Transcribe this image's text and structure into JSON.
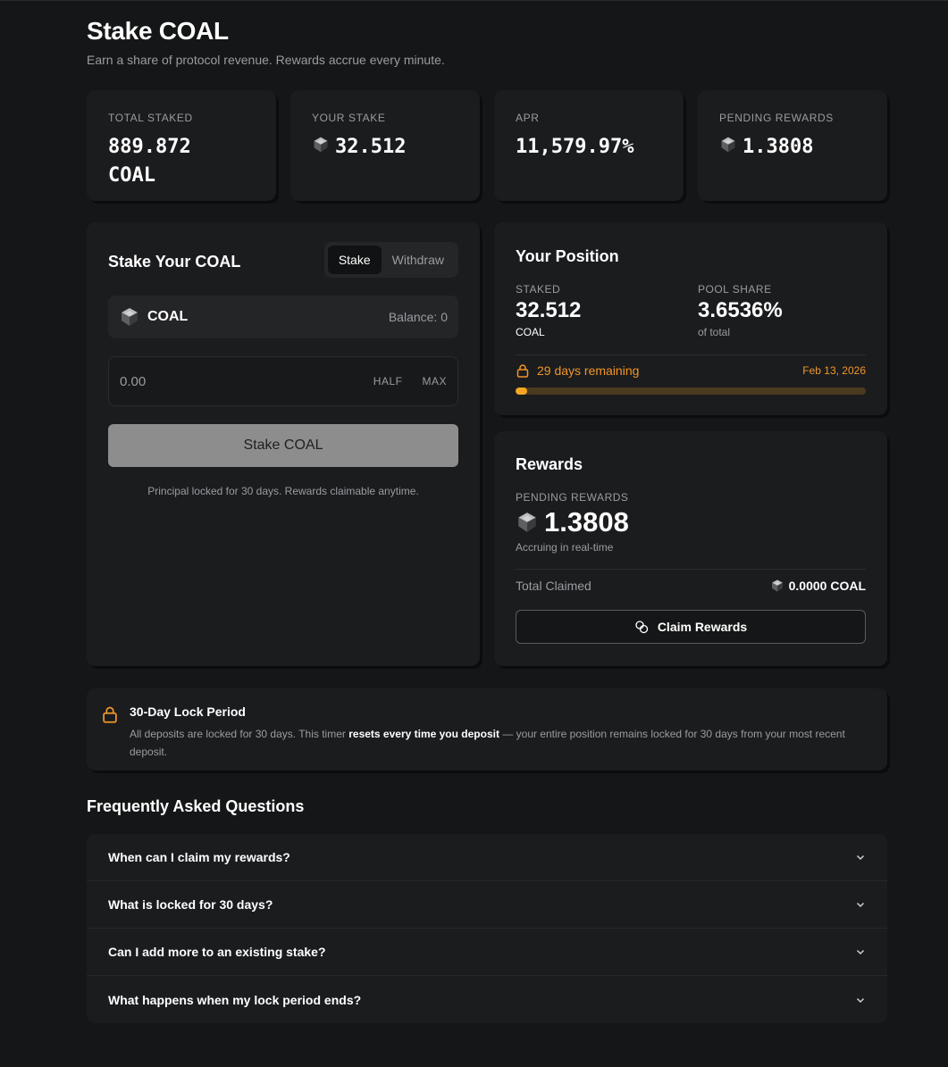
{
  "header": {
    "title": "Stake COAL",
    "subtitle": "Earn a share of protocol revenue. Rewards accrue every minute."
  },
  "stats": [
    {
      "label": "TOTAL STAKED",
      "value": "889.872 COAL",
      "value_line1": "889.872",
      "value_line2": "COAL",
      "icon": null
    },
    {
      "label": "YOUR STAKE",
      "value": "32.512",
      "icon": "coal-icon"
    },
    {
      "label": "APR",
      "value": "11,579.97%",
      "icon": null
    },
    {
      "label": "PENDING REWARDS",
      "value": "1.3808",
      "icon": "coal-icon"
    }
  ],
  "stake_panel": {
    "title": "Stake Your COAL",
    "tabs": [
      {
        "label": "Stake",
        "active": true
      },
      {
        "label": "Withdraw",
        "active": false
      }
    ],
    "token_name": "COAL",
    "balance": "Balance: 0",
    "amount_placeholder": "0.00",
    "half_label": "HALF",
    "max_label": "MAX",
    "stake_button": "Stake COAL",
    "note": "Principal locked for 30 days. Rewards claimable anytime."
  },
  "position": {
    "title": "Your Position",
    "staked_label": "STAKED",
    "staked_value": "32.512",
    "staked_unit": "COAL",
    "share_label": "POOL SHARE",
    "share_value": "3.6536%",
    "share_unit": "of total",
    "lock_text": "29 days remaining",
    "lock_date": "Feb 13, 2026",
    "lock_progress": 0.033
  },
  "rewards": {
    "title": "Rewards",
    "pending_label": "PENDING REWARDS",
    "pending_value": "1.3808",
    "pending_note": "Accruing in real-time",
    "total_claimed_label": "Total Claimed",
    "total_claimed_value": "0.0000 COAL",
    "claim_button": "Claim Rewards"
  },
  "lock_notice": {
    "title": "30-Day Lock Period",
    "text_before": "All deposits are locked for 30 days. This timer ",
    "text_bold": "resets every time you deposit",
    "text_after": " — your entire position remains locked for 30 days from your most recent deposit."
  },
  "faq": {
    "title": "Frequently Asked Questions",
    "items": [
      "When can I claim my rewards?",
      "What is locked for 30 days?",
      "Can I add more to an existing stake?",
      "What happens when my lock period ends?"
    ]
  },
  "colors": {
    "background": "#151617",
    "card": "#1b1c1e",
    "accent_orange": "#f0962a",
    "progress_fill": "#f5a623",
    "muted_text": "#9a9ca1"
  }
}
